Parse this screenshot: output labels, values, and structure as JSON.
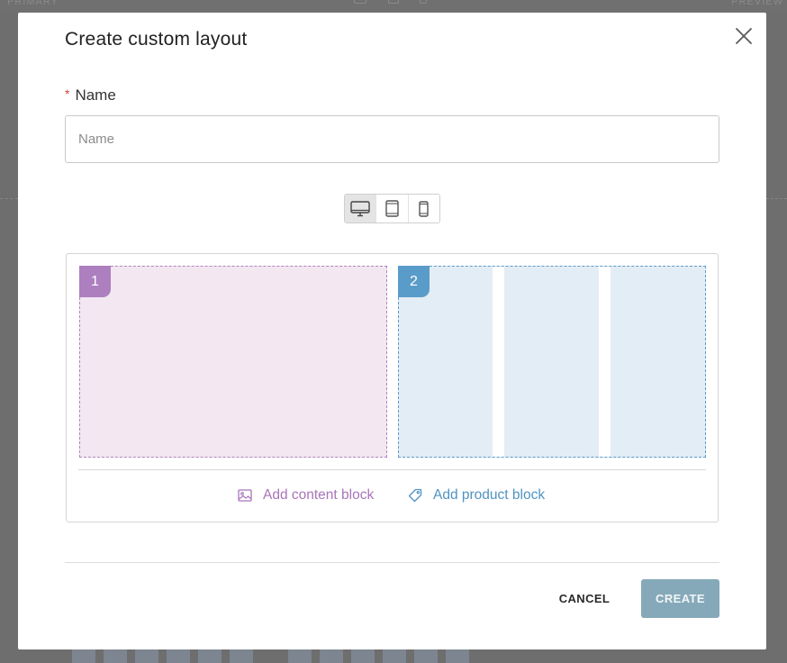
{
  "background": {
    "top_label": "PRIMARY",
    "preview_label": "PREVIEW"
  },
  "modal": {
    "title": "Create custom layout",
    "close_icon": "close-icon"
  },
  "name_field": {
    "required_marker": "*",
    "label": "Name",
    "value": "",
    "placeholder": "Name"
  },
  "device_toggle": {
    "options": [
      {
        "icon": "desktop-icon",
        "active": true
      },
      {
        "icon": "tablet-icon",
        "active": false
      },
      {
        "icon": "mobile-icon",
        "active": false
      }
    ]
  },
  "layout": {
    "blocks": [
      {
        "number": "1",
        "type": "content",
        "color": "#ad7fbf"
      },
      {
        "number": "2",
        "type": "product",
        "color": "#5a9cc9",
        "columns": 3
      }
    ],
    "add_content_label": "Add content block",
    "add_content_icon": "image-icon",
    "add_product_label": "Add product block",
    "add_product_icon": "tag-icon"
  },
  "footer": {
    "cancel_label": "CANCEL",
    "create_label": "CREATE"
  },
  "colors": {
    "content_accent": "#a875b8",
    "product_accent": "#4f93c1",
    "create_button": "#85a9b9",
    "required": "#d0463b"
  }
}
